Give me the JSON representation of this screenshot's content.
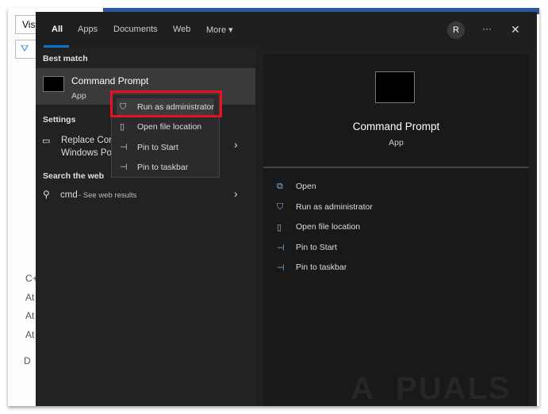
{
  "background": {
    "visible_text": [
      "Vis",
      "C+",
      "At",
      "At",
      "At",
      "D"
    ]
  },
  "tabs": [
    {
      "label": "All"
    },
    {
      "label": "Apps"
    },
    {
      "label": "Documents"
    },
    {
      "label": "Web"
    },
    {
      "label": "More ▾"
    }
  ],
  "header": {
    "avatar": "R",
    "more": "···",
    "close": "✕"
  },
  "left": {
    "best_match_label": "Best match",
    "best_match": {
      "title": "Command Prompt",
      "subtitle": "App"
    },
    "settings_label": "Settings",
    "settings_item": {
      "line1": "Replace Cor",
      "line2": "Windows Po"
    },
    "web_label": "Search the web",
    "web_item": {
      "query": "cmd",
      "suffix": " - See web results"
    }
  },
  "context_menu": [
    {
      "label": "Run as administrator",
      "icon": "shield-icon"
    },
    {
      "label": "Open file location",
      "icon": "folder-icon"
    },
    {
      "label": "Pin to Start",
      "icon": "pin-icon"
    },
    {
      "label": "Pin to taskbar",
      "icon": "pin-icon"
    }
  ],
  "preview": {
    "title": "Command Prompt",
    "subtitle": "App",
    "actions": [
      {
        "label": "Open"
      },
      {
        "label": "Run as administrator"
      },
      {
        "label": "Open file location"
      },
      {
        "label": "Pin to Start"
      },
      {
        "label": "Pin to taskbar"
      }
    ]
  },
  "watermark": "APPUALS"
}
